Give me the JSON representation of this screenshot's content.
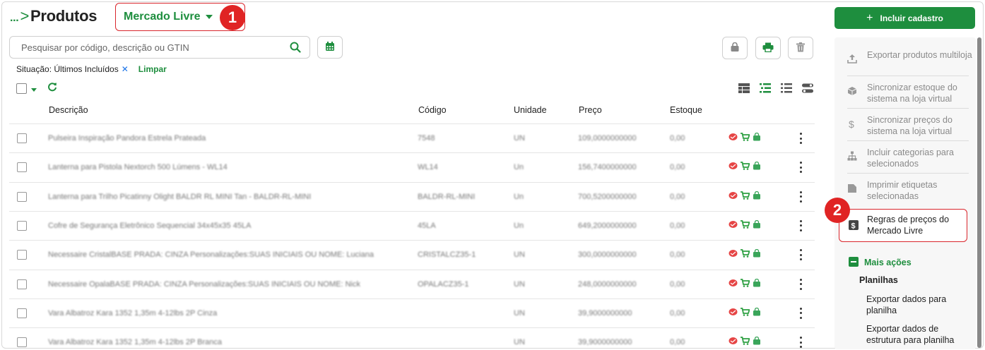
{
  "header": {
    "breadcrumb_dots": "...",
    "breadcrumb_sep": ">",
    "title": "Produtos",
    "store_selector": "Mercado Livre",
    "badge_1": "1",
    "badge_2": "2"
  },
  "search": {
    "placeholder": "Pesquisar por código, descrição ou GTIN"
  },
  "filter": {
    "label": "Situação: Últimos Incluídos",
    "clear": "Limpar"
  },
  "table": {
    "columns": [
      "Descrição",
      "Código",
      "Unidade",
      "Preço",
      "Estoque"
    ],
    "rows": [
      {
        "descricao": "Pulseira Inspiração Pandora Estrela Prateada",
        "codigo": "7548",
        "unidade": "UN",
        "preco": "109,0000000000",
        "estoque": "0,00"
      },
      {
        "descricao": "Lanterna para Pistola Nextorch 500 Lúmens - WL14",
        "codigo": "WL14",
        "unidade": "Un",
        "preco": "156,7400000000",
        "estoque": "0,00"
      },
      {
        "descricao": "Lanterna para Trilho Picatinny Olight BALDR RL MINI Tan - BALDR-RL-MINI",
        "codigo": "BALDR-RL-MINI",
        "unidade": "Un",
        "preco": "700,5200000000",
        "estoque": "0,00"
      },
      {
        "descricao": "Cofre de Segurança Eletrônico Sequencial 34x45x35 45LA",
        "codigo": "45LA",
        "unidade": "Un",
        "preco": "649,2000000000",
        "estoque": "0,00"
      },
      {
        "descricao": "Necessaire CristalBASE PRADA: CINZA Personalizações:SUAS INICIAIS OU NOME: Luciana",
        "codigo": "CRISTALCZ35-1",
        "unidade": "UN",
        "preco": "300,0000000000",
        "estoque": "0,00"
      },
      {
        "descricao": "Necessaire OpalaBASE PRADA: CINZA Personalizações:SUAS INICIAIS OU NOME: Nick",
        "codigo": "OPALACZ35-1",
        "unidade": "UN",
        "preco": "248,0000000000",
        "estoque": "0,00"
      },
      {
        "descricao": "Vara Albatroz Kara 1352 1,35m 4-12lbs 2P Cinza",
        "codigo": "",
        "unidade": "UN",
        "preco": "39,9000000000",
        "estoque": "0,00"
      },
      {
        "descricao": "Vara Albatroz Kara 1352 1,35m 4-12lbs 2P Branca",
        "codigo": "",
        "unidade": "UN",
        "preco": "39,9000000000",
        "estoque": "0,00"
      }
    ]
  },
  "sidebar": {
    "primary_button": "Incluir cadastro",
    "actions": [
      {
        "label": "Exportar produtos multiloja",
        "icon": "upload-icon"
      },
      {
        "label": "Sincronizar estoque do sistema na loja virtual",
        "icon": "box-icon"
      },
      {
        "label": "Sincronizar preços do sistema na loja virtual",
        "icon": "dollar-icon"
      },
      {
        "label": "Incluir categorias para selecionados",
        "icon": "sitemap-icon"
      },
      {
        "label": "Imprimir etiquetas selecionadas",
        "icon": "tag-icon"
      },
      {
        "label": "Regras de preços do Mercado Livre",
        "icon": "price-rule-icon"
      }
    ],
    "more_actions": "Mais ações",
    "planilhas_title": "Planilhas",
    "planilhas": [
      "Exportar dados para planilha",
      "Exportar dados de estrutura para planilha"
    ]
  },
  "colors": {
    "accent": "#1e8e3e",
    "highlight": "#d9262c",
    "badge": "#e02424"
  }
}
